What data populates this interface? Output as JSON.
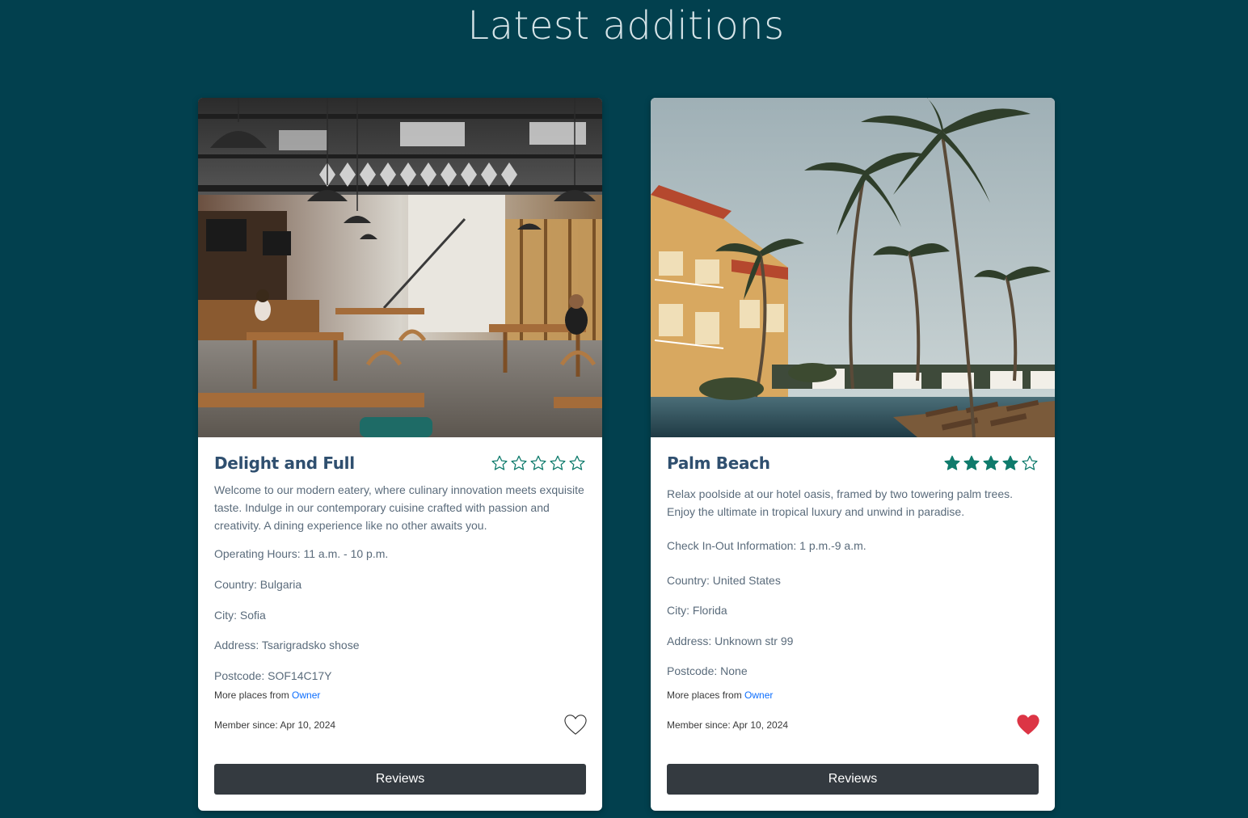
{
  "page": {
    "title": "Latest additions"
  },
  "colors": {
    "background": "#02404e",
    "card": "#ffffff",
    "title_text": "#2f4f6f",
    "star": "#0f7b6c",
    "heart_filled": "#dc3545",
    "button": "#343a40",
    "link": "#0d6efd"
  },
  "cards": [
    {
      "title": "Delight and Full",
      "image": "restaurant-interior-photo",
      "rating": 0,
      "rating_max": 5,
      "description": "Welcome to our modern eatery, where culinary innovation meets exquisite taste. Indulge in our contemporary cuisine crafted with passion and creativity. A dining experience like no other awaits you.",
      "hours_line": "Operating Hours: 11 a.m. - 10 p.m.",
      "country_line": "Country: Bulgaria",
      "city_line": "City: Sofia",
      "address_line": "Address: Tsarigradsko shose",
      "postcode_line": "Postcode: SOF14C17Y",
      "more_places_prefix": "More places from",
      "owner_link": "Owner",
      "member_since": "Member since: Apr 10, 2024",
      "favorited": false,
      "heart_icon": "heart-outline-icon",
      "reviews_label": "Reviews"
    },
    {
      "title": "Palm Beach",
      "image": "hotel-pool-palm-trees-photo",
      "rating": 4,
      "rating_max": 5,
      "description": "Relax poolside at our hotel oasis, framed by two towering palm trees. Enjoy the ultimate in tropical luxury and unwind in paradise.",
      "hours_line": "Check In-Out Information: 1 p.m.-9 a.m.",
      "country_line": "Country: United States",
      "city_line": "City: Florida",
      "address_line": "Address: Unknown str 99",
      "postcode_line": "Postcode: None",
      "more_places_prefix": "More places from",
      "owner_link": "Owner",
      "member_since": "Member since: Apr 10, 2024",
      "favorited": true,
      "heart_icon": "heart-filled-icon",
      "reviews_label": "Reviews"
    }
  ]
}
